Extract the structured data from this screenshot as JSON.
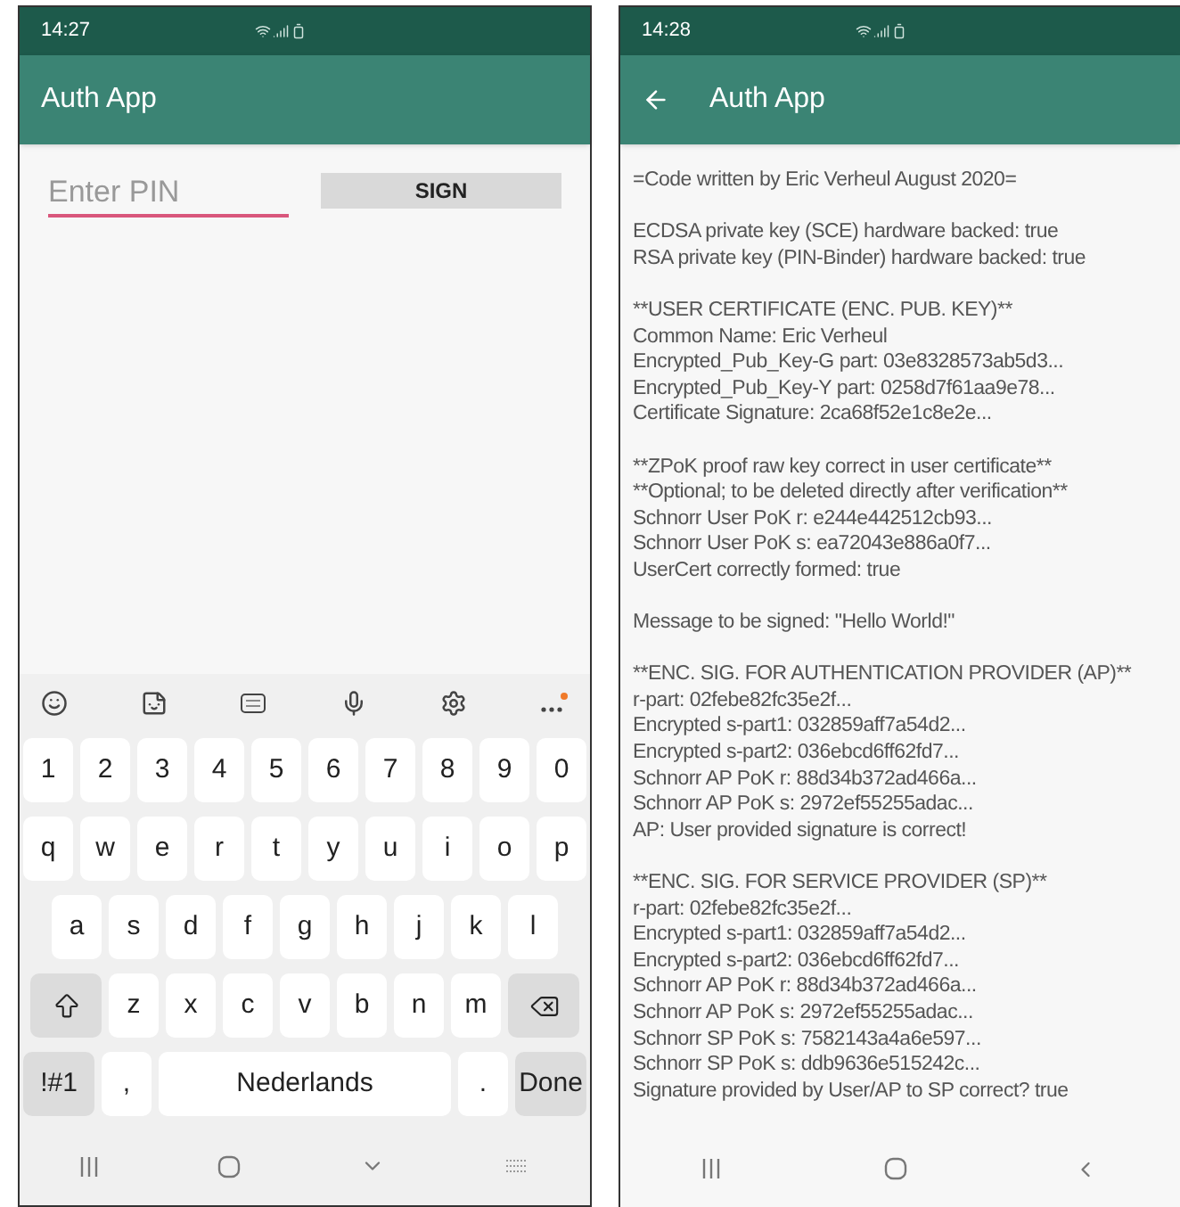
{
  "pin_screen": {
    "status_bar": {
      "time": "14:27"
    },
    "app_bar": {
      "title": "Auth App",
      "has_back": false
    },
    "pin_field": {
      "placeholder": "Enter PIN"
    },
    "sign_button": {
      "label": "SIGN"
    },
    "keyboard": {
      "more_has_dot": true,
      "rows": [
        [
          {
            "kind": "char",
            "label": "1"
          },
          {
            "kind": "char",
            "label": "2"
          },
          {
            "kind": "char",
            "label": "3"
          },
          {
            "kind": "char",
            "label": "4"
          },
          {
            "kind": "char",
            "label": "5"
          },
          {
            "kind": "char",
            "label": "6"
          },
          {
            "kind": "char",
            "label": "7"
          },
          {
            "kind": "char",
            "label": "8"
          },
          {
            "kind": "char",
            "label": "9"
          },
          {
            "kind": "char",
            "label": "0"
          }
        ],
        [
          {
            "kind": "char",
            "label": "q"
          },
          {
            "kind": "char",
            "label": "w"
          },
          {
            "kind": "char",
            "label": "e"
          },
          {
            "kind": "char",
            "label": "r"
          },
          {
            "kind": "char",
            "label": "t"
          },
          {
            "kind": "char",
            "label": "y"
          },
          {
            "kind": "char",
            "label": "u"
          },
          {
            "kind": "char",
            "label": "i"
          },
          {
            "kind": "char",
            "label": "o"
          },
          {
            "kind": "char",
            "label": "p"
          }
        ],
        [
          {
            "kind": "char",
            "label": "a"
          },
          {
            "kind": "char",
            "label": "s"
          },
          {
            "kind": "char",
            "label": "d"
          },
          {
            "kind": "char",
            "label": "f"
          },
          {
            "kind": "char",
            "label": "g"
          },
          {
            "kind": "char",
            "label": "h"
          },
          {
            "kind": "char",
            "label": "j"
          },
          {
            "kind": "char",
            "label": "k"
          },
          {
            "kind": "char",
            "label": "l"
          }
        ],
        [
          {
            "kind": "shift"
          },
          {
            "kind": "char",
            "label": "z"
          },
          {
            "kind": "char",
            "label": "x"
          },
          {
            "kind": "char",
            "label": "c"
          },
          {
            "kind": "char",
            "label": "v"
          },
          {
            "kind": "char",
            "label": "b"
          },
          {
            "kind": "char",
            "label": "n"
          },
          {
            "kind": "char",
            "label": "m"
          },
          {
            "kind": "backspace"
          }
        ]
      ],
      "bottom_row": {
        "symbols_key": "!#1",
        "comma_key": ",",
        "space_key": "Nederlands",
        "period_key": ".",
        "done_key": "Done"
      }
    }
  },
  "output_screen": {
    "status_bar": {
      "time": "14:28"
    },
    "app_bar": {
      "title": "Auth App",
      "has_back": true
    },
    "paragraphs": [
      [
        "=Code written by Eric Verheul August 2020="
      ],
      [
        "ECDSA private key (SCE) hardware backed: true",
        "RSA private key (PIN-Binder) hardware backed: true"
      ],
      [
        "**USER CERTIFICATE (ENC. PUB. KEY)**",
        "Common Name: Eric Verheul",
        "Encrypted_Pub_Key-G part: 03e8328573ab5d3...",
        "Encrypted_Pub_Key-Y part: 0258d7f61aa9e78...",
        "Certificate Signature: 2ca68f52e1c8e2e..."
      ],
      [
        "**ZPoK proof raw key correct in user certificate**",
        "**Optional; to be deleted directly after verification**",
        "Schnorr User PoK r: e244e442512cb93...",
        "Schnorr User PoK s: ea72043e886a0f7...",
        "UserCert correctly formed: true"
      ],
      [
        "Message to be signed: \"Hello World!\""
      ],
      [
        "**ENC. SIG. FOR AUTHENTICATION PROVIDER (AP)**",
        "r-part: 02febe82fc35e2f...",
        "Encrypted s-part1: 032859aff7a54d2...",
        "Encrypted s-part2: 036ebcd6ff62fd7...",
        "Schnorr AP PoK r: 88d34b372ad466a...",
        "Schnorr AP PoK s: 2972ef55255adac...",
        "AP: User provided signature is correct!"
      ],
      [
        "**ENC. SIG. FOR SERVICE PROVIDER (SP)**",
        "r-part: 02febe82fc35e2f...",
        "Encrypted s-part1: 032859aff7a54d2...",
        "Encrypted s-part2: 036ebcd6ff62fd7...",
        "Schnorr AP PoK r: 88d34b372ad466a...",
        "Schnorr AP PoK s: 2972ef55255adac...",
        "Schnorr SP PoK s: 7582143a4a6e597...",
        "Schnorr SP PoK s: ddb9636e515242c...",
        "Signature provided by User/AP to SP correct? true"
      ]
    ]
  }
}
